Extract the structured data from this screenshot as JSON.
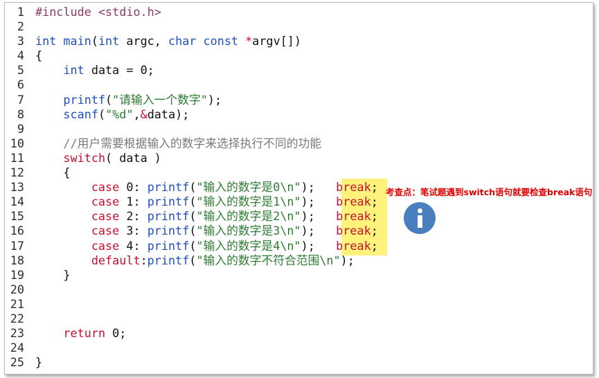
{
  "editor": {
    "lines": [
      {
        "n": "1",
        "tokens": [
          [
            "pp",
            "#include "
          ],
          [
            "pp",
            "<stdio.h>"
          ]
        ]
      },
      {
        "n": "2",
        "tokens": []
      },
      {
        "n": "3",
        "tokens": [
          [
            "ty",
            "int"
          ],
          [
            "id",
            " "
          ],
          [
            "fn",
            "main"
          ],
          [
            "pu",
            "("
          ],
          [
            "ty",
            "int"
          ],
          [
            "id",
            " argc, "
          ],
          [
            "ty",
            "char"
          ],
          [
            "id",
            " "
          ],
          [
            "ty",
            "const"
          ],
          [
            "id",
            " "
          ],
          [
            "kw",
            "*"
          ],
          [
            "id",
            "argv[])"
          ]
        ]
      },
      {
        "n": "4",
        "tokens": [
          [
            "pu",
            "{"
          ]
        ]
      },
      {
        "n": "5",
        "tokens": [
          [
            "id",
            "    "
          ],
          [
            "ty",
            "int"
          ],
          [
            "id",
            " data = "
          ],
          [
            "num",
            "0"
          ],
          [
            "pu",
            ";"
          ]
        ]
      },
      {
        "n": "6",
        "tokens": []
      },
      {
        "n": "7",
        "tokens": [
          [
            "id",
            "    "
          ],
          [
            "fn",
            "printf"
          ],
          [
            "pu",
            "("
          ],
          [
            "str",
            "\"请输入一个数字\""
          ],
          [
            "pu",
            ");"
          ]
        ]
      },
      {
        "n": "8",
        "tokens": [
          [
            "id",
            "    "
          ],
          [
            "fn",
            "scanf"
          ],
          [
            "pu",
            "("
          ],
          [
            "str",
            "\"%d\""
          ],
          [
            "pu",
            ","
          ],
          [
            "kw",
            "&"
          ],
          [
            "id",
            "data);"
          ]
        ]
      },
      {
        "n": "9",
        "tokens": []
      },
      {
        "n": "10",
        "tokens": [
          [
            "id",
            "    "
          ],
          [
            "cm",
            "//用户需要根据输入的数字来选择执行不同的功能"
          ]
        ]
      },
      {
        "n": "11",
        "tokens": [
          [
            "id",
            "    "
          ],
          [
            "kw",
            "switch"
          ],
          [
            "pu",
            "( "
          ],
          [
            "id",
            "data )"
          ]
        ]
      },
      {
        "n": "12",
        "tokens": [
          [
            "id",
            "    "
          ],
          [
            "pu",
            "{"
          ]
        ]
      },
      {
        "n": "13",
        "tokens": [
          [
            "id",
            "        "
          ],
          [
            "kw",
            "case"
          ],
          [
            "id",
            " "
          ],
          [
            "num",
            "0"
          ],
          [
            "pu",
            ": "
          ],
          [
            "fn",
            "printf"
          ],
          [
            "pu",
            "("
          ],
          [
            "str",
            "\"输入的数字是0\\n\""
          ],
          [
            "pu",
            ");   "
          ],
          [
            "kw",
            "break"
          ],
          [
            "pu",
            ";"
          ]
        ]
      },
      {
        "n": "14",
        "tokens": [
          [
            "id",
            "        "
          ],
          [
            "kw",
            "case"
          ],
          [
            "id",
            " "
          ],
          [
            "num",
            "1"
          ],
          [
            "pu",
            ": "
          ],
          [
            "fn",
            "printf"
          ],
          [
            "pu",
            "("
          ],
          [
            "str",
            "\"输入的数字是1\\n\""
          ],
          [
            "pu",
            ");   "
          ],
          [
            "kw",
            "break"
          ],
          [
            "pu",
            ";"
          ]
        ]
      },
      {
        "n": "15",
        "tokens": [
          [
            "id",
            "        "
          ],
          [
            "kw",
            "case"
          ],
          [
            "id",
            " "
          ],
          [
            "num",
            "2"
          ],
          [
            "pu",
            ": "
          ],
          [
            "fn",
            "printf"
          ],
          [
            "pu",
            "("
          ],
          [
            "str",
            "\"输入的数字是2\\n\""
          ],
          [
            "pu",
            ");   "
          ],
          [
            "kw",
            "break"
          ],
          [
            "pu",
            ";"
          ]
        ]
      },
      {
        "n": "16",
        "tokens": [
          [
            "id",
            "        "
          ],
          [
            "kw",
            "case"
          ],
          [
            "id",
            " "
          ],
          [
            "num",
            "3"
          ],
          [
            "pu",
            ": "
          ],
          [
            "fn",
            "printf"
          ],
          [
            "pu",
            "("
          ],
          [
            "str",
            "\"输入的数字是3\\n\""
          ],
          [
            "pu",
            ");   "
          ],
          [
            "kw",
            "break"
          ],
          [
            "pu",
            ";"
          ]
        ]
      },
      {
        "n": "17",
        "tokens": [
          [
            "id",
            "        "
          ],
          [
            "kw",
            "case"
          ],
          [
            "id",
            " "
          ],
          [
            "num",
            "4"
          ],
          [
            "pu",
            ": "
          ],
          [
            "fn",
            "printf"
          ],
          [
            "pu",
            "("
          ],
          [
            "str",
            "\"输入的数字是4\\n\""
          ],
          [
            "pu",
            ");   "
          ],
          [
            "kw",
            "break"
          ],
          [
            "pu",
            ";"
          ]
        ]
      },
      {
        "n": "18",
        "tokens": [
          [
            "id",
            "        "
          ],
          [
            "kw",
            "default"
          ],
          [
            "pu",
            ":"
          ],
          [
            "fn",
            "printf"
          ],
          [
            "pu",
            "("
          ],
          [
            "str",
            "\"输入的数字不符合范围\\n\""
          ],
          [
            "pu",
            ");"
          ]
        ]
      },
      {
        "n": "19",
        "tokens": [
          [
            "id",
            "    "
          ],
          [
            "pu",
            "}"
          ]
        ]
      },
      {
        "n": "20",
        "tokens": []
      },
      {
        "n": "21",
        "tokens": []
      },
      {
        "n": "22",
        "tokens": []
      },
      {
        "n": "23",
        "tokens": [
          [
            "id",
            "    "
          ],
          [
            "kw",
            "return"
          ],
          [
            "id",
            " "
          ],
          [
            "num",
            "0"
          ],
          [
            "pu",
            ";"
          ]
        ]
      },
      {
        "n": "24",
        "tokens": []
      },
      {
        "n": "25",
        "tokens": [
          [
            "pu",
            "}"
          ]
        ]
      }
    ]
  },
  "annotation": {
    "note": "考查点：笔试题遇到switch语句就要检查break语句",
    "highlight_color": "#fff27a",
    "note_color": "#e00000",
    "icon": "info-icon",
    "icon_color": "#4a7fbf"
  }
}
